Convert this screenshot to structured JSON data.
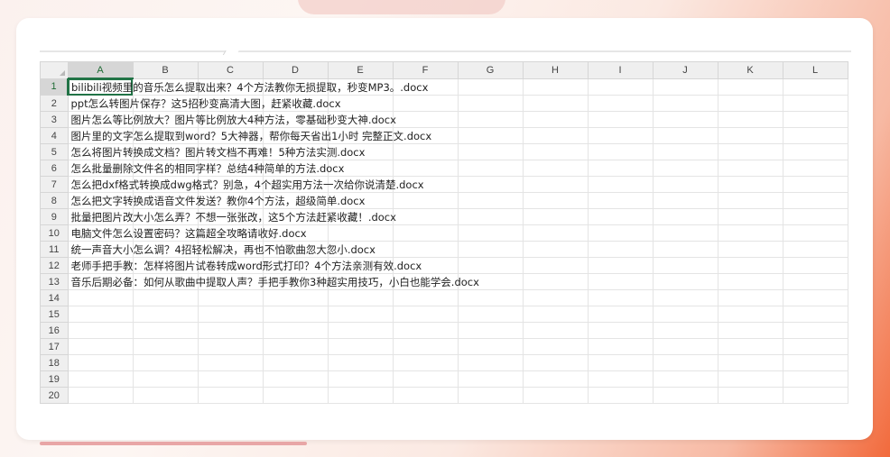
{
  "columns": [
    "A",
    "B",
    "C",
    "D",
    "E",
    "F",
    "G",
    "H",
    "I",
    "J",
    "K",
    "L"
  ],
  "selected_cell": "A1",
  "rows": [
    {
      "num": "1",
      "text": "bilibili视频里的音乐怎么提取出来？4个方法教你无损提取，秒变MP3。.docx"
    },
    {
      "num": "2",
      "text": "ppt怎么转图片保存？这5招秒变高清大图，赶紧收藏.docx"
    },
    {
      "num": "3",
      "text": "图片怎么等比例放大？图片等比例放大4种方法，零基础秒变大神.docx"
    },
    {
      "num": "4",
      "text": "图片里的文字怎么提取到word？5大神器，帮你每天省出1小时 完整正文.docx"
    },
    {
      "num": "5",
      "text": "怎么将图片转换成文档？图片转文档不再难！5种方法实测.docx"
    },
    {
      "num": "6",
      "text": "怎么批量删除文件名的相同字样？总结4种简单的方法.docx"
    },
    {
      "num": "7",
      "text": "怎么把dxf格式转换成dwg格式？别急，4个超实用方法一次给你说清楚.docx"
    },
    {
      "num": "8",
      "text": "怎么把文字转换成语音文件发送？教你4个方法，超级简单.docx"
    },
    {
      "num": "9",
      "text": "批量把图片改大小怎么弄？不想一张张改，这5个方法赶紧收藏！.docx"
    },
    {
      "num": "10",
      "text": "电脑文件怎么设置密码？这篇超全攻略请收好.docx"
    },
    {
      "num": "11",
      "text": "统一声音大小怎么调？4招轻松解决，再也不怕歌曲忽大忽小.docx"
    },
    {
      "num": "12",
      "text": "老师手把手教：怎样将图片试卷转成word形式打印？4个方法亲测有效.docx"
    },
    {
      "num": "13",
      "text": "音乐后期必备：如何从歌曲中提取人声？手把手教你3种超实用技巧，小白也能学会.docx"
    },
    {
      "num": "14",
      "text": ""
    },
    {
      "num": "15",
      "text": ""
    },
    {
      "num": "16",
      "text": ""
    },
    {
      "num": "17",
      "text": ""
    },
    {
      "num": "18",
      "text": ""
    },
    {
      "num": "19",
      "text": ""
    },
    {
      "num": "20",
      "text": ""
    }
  ]
}
